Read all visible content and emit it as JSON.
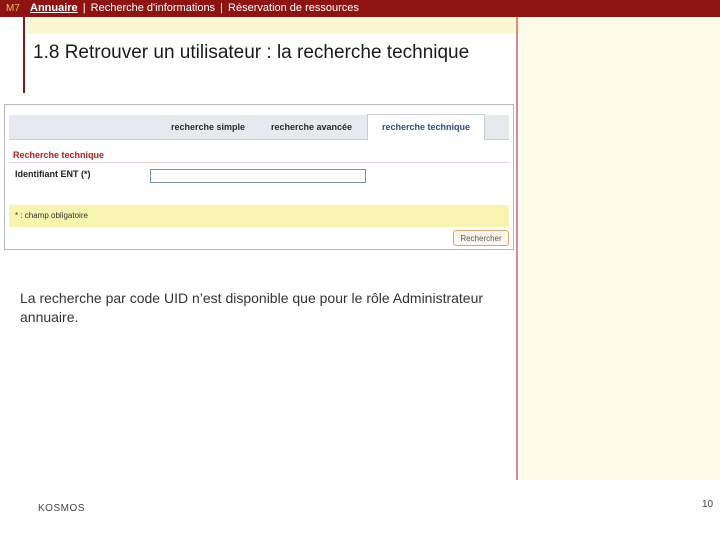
{
  "header": {
    "module_tag": "M7",
    "breadcrumb": {
      "current": "Annuaire",
      "separator": "|",
      "items": [
        "Recherche d'informations",
        "Réservation de ressources"
      ]
    }
  },
  "slide": {
    "title": "1.8  Retrouver un utilisateur : la recherche technique"
  },
  "screenshot": {
    "tabs": [
      {
        "label": "recherche simple",
        "active": false
      },
      {
        "label": "recherche avancée",
        "active": false
      },
      {
        "label": "recherche technique",
        "active": true
      }
    ],
    "section_title": "Recherche technique",
    "field_label": "Identifiant ENT (*)",
    "field_value": "",
    "required_note": "* : champ obligatoire",
    "search_button": "Rechercher"
  },
  "description": "La recherche par code UID n’est disponible que pour le rôle Administrateur annuaire.",
  "footer": {
    "brand": "KOSMOS",
    "page_number": "10"
  },
  "colors": {
    "topbar": "#8e1413",
    "accent_yellow": "#fbf7d0",
    "active_tab_text": "#2a4f86",
    "section_title": "#b02020"
  }
}
